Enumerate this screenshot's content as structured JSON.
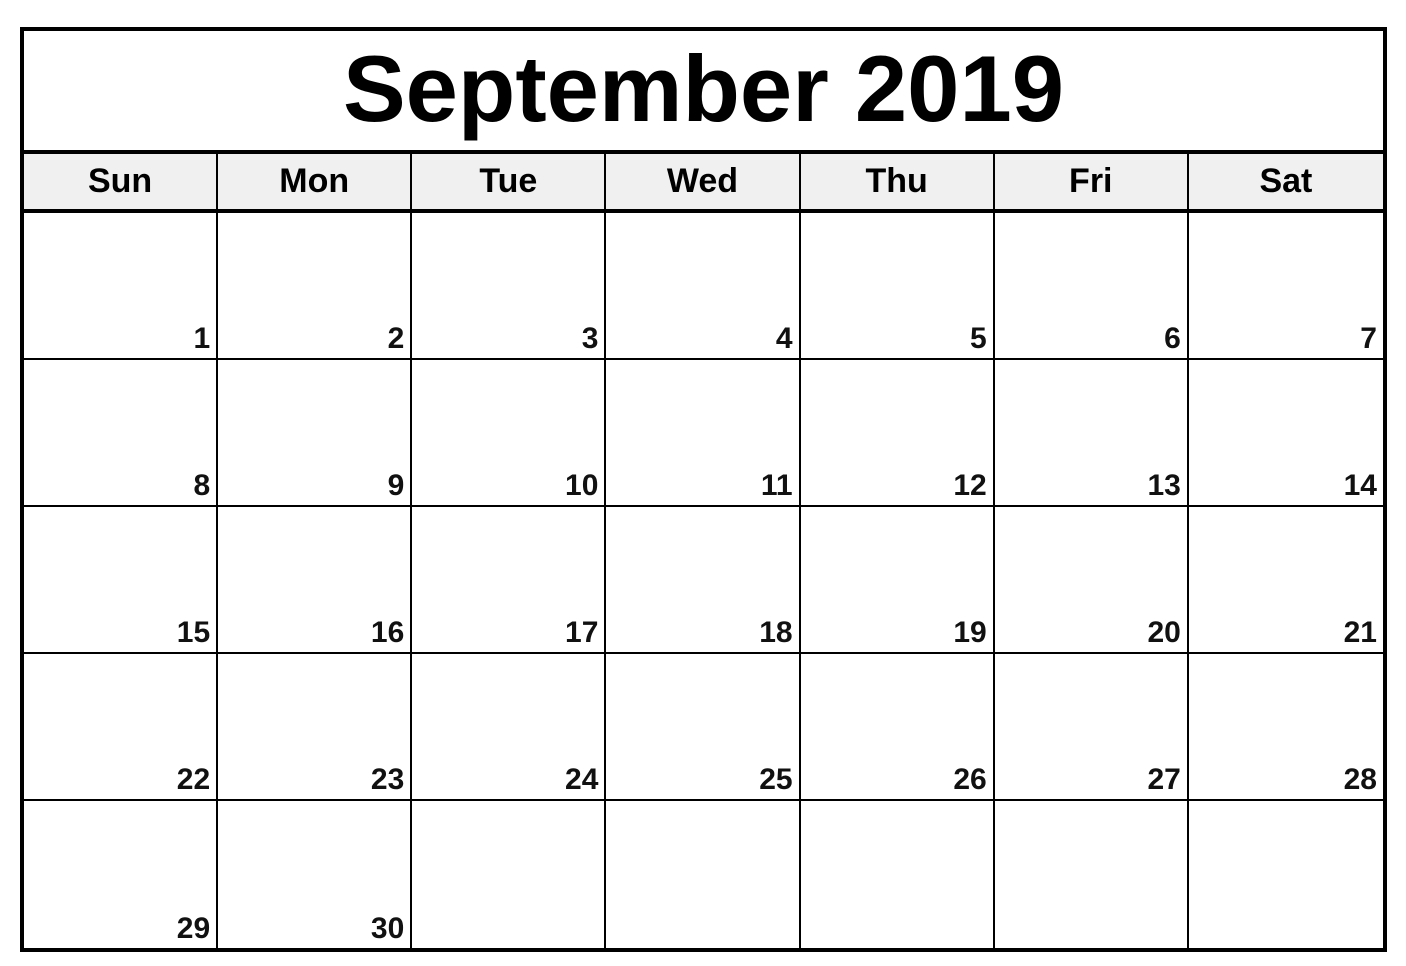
{
  "calendar": {
    "title": "September 2019",
    "weekdays": [
      "Sun",
      "Mon",
      "Tue",
      "Wed",
      "Thu",
      "Fri",
      "Sat"
    ],
    "weeks": [
      [
        "1",
        "2",
        "3",
        "4",
        "5",
        "6",
        "7"
      ],
      [
        "8",
        "9",
        "10",
        "11",
        "12",
        "13",
        "14"
      ],
      [
        "15",
        "16",
        "17",
        "18",
        "19",
        "20",
        "21"
      ],
      [
        "22",
        "23",
        "24",
        "25",
        "26",
        "27",
        "28"
      ],
      [
        "29",
        "30",
        "",
        "",
        "",
        "",
        ""
      ]
    ]
  }
}
